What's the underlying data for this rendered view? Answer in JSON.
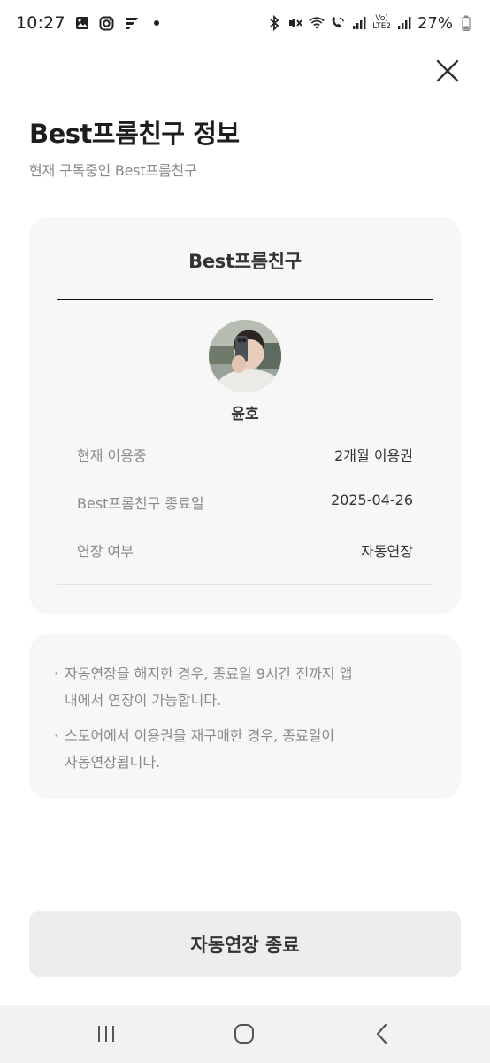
{
  "status_bar": {
    "time": "10:27",
    "battery": "27%",
    "volte_top": "Vo)",
    "volte_bottom": "LTE2",
    "left_icons": [
      "gallery-icon",
      "instagram-icon",
      "app-icon",
      "dot-icon"
    ],
    "right_icons": [
      "bluetooth-icon",
      "mute-icon",
      "wifi-icon",
      "wifi-call-icon",
      "signal-icon",
      "signal-icon",
      "battery-icon"
    ]
  },
  "header": {
    "title": "Best프롬친구 정보",
    "subtitle": "현재 구독중인 Best프롬친구"
  },
  "card": {
    "title": "Best프롬친구",
    "profile_name": "윤호",
    "rows": [
      {
        "label": "현재 이용중",
        "value": "2개월 이용권"
      },
      {
        "label": "Best프롬친구 종료일",
        "value": "2025-04-26"
      },
      {
        "label": "연장 여부",
        "value": "자동연장"
      }
    ]
  },
  "notice": {
    "bullet": "·",
    "items": [
      {
        "line1": "자동연장을 해지한 경우, 종료일 9시간 전까지 앱",
        "line2": "내에서 연장이 가능합니다."
      },
      {
        "line1": "스토어에서 이용권을 재구매한 경우, 종료일이",
        "line2": "자동연장됩니다."
      }
    ]
  },
  "action": {
    "end_auto_renew_label": "자동연장 종료"
  },
  "colors": {
    "background": "#ffffff",
    "card_bg": "#f7f7f8",
    "muted_text": "#8a8a8a",
    "primary_text": "#333333",
    "button_bg": "#ededee",
    "nav_bg": "#f2f2f3"
  }
}
